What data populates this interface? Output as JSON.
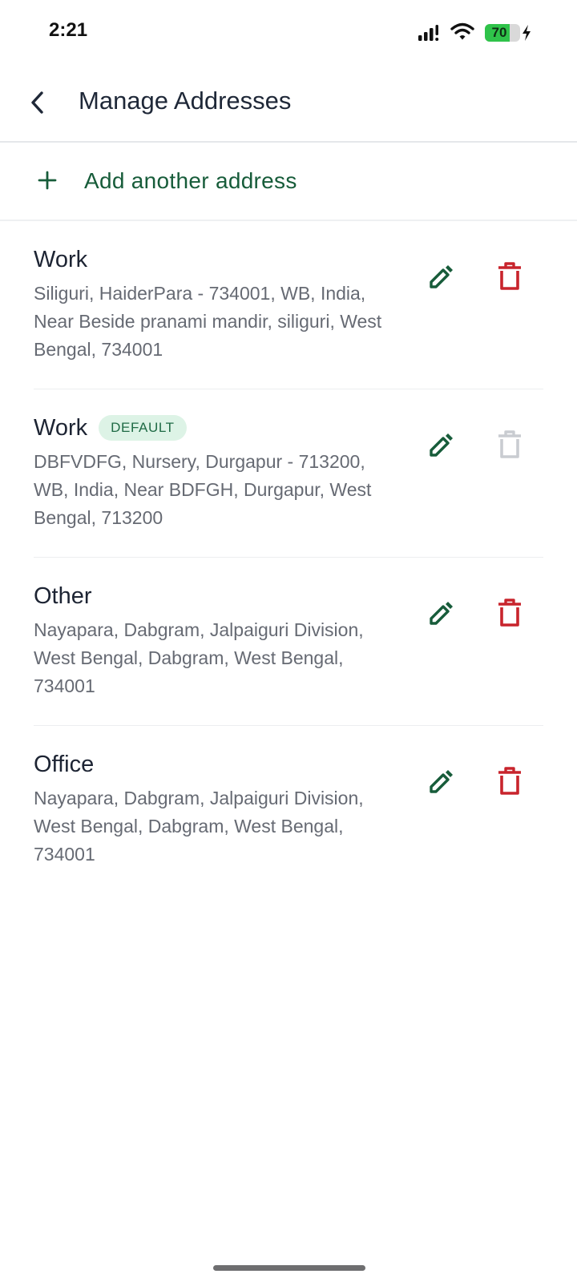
{
  "status_bar": {
    "time": "2:21",
    "battery_level": 70,
    "battery_text": "70",
    "icons": [
      "signal-icon",
      "wifi-icon",
      "battery-icon",
      "charging-bolt-icon"
    ]
  },
  "header": {
    "title": "Manage Addresses",
    "back_icon": "chevron-left-icon"
  },
  "add_address": {
    "label": "Add another address",
    "icon": "plus-icon"
  },
  "addresses": [
    {
      "title": "Work",
      "is_default": false,
      "badge": "",
      "text": "Siliguri, HaiderPara - 734001, WB, India, Near Beside pranami mandir, siliguri, West Bengal, 734001",
      "delete_enabled": true
    },
    {
      "title": "Work",
      "is_default": true,
      "badge": "DEFAULT",
      "text": "DBFVDFG, Nursery, Durgapur - 713200, WB, India, Near BDFGH, Durgapur, West Bengal, 713200",
      "delete_enabled": false
    },
    {
      "title": "Other",
      "is_default": false,
      "badge": "",
      "text": "Nayapara, Dabgram, Jalpaiguri Division, West Bengal, Dabgram, West Bengal, 734001",
      "delete_enabled": true
    },
    {
      "title": "Office",
      "is_default": false,
      "badge": "",
      "text": "Nayapara, Dabgram, Jalpaiguri Division, West Bengal, Dabgram, West Bengal, 734001",
      "delete_enabled": true
    }
  ],
  "colors": {
    "primary_green": "#175c3a",
    "delete_red": "#c8242c",
    "delete_disabled": "#c9ccd1",
    "badge_bg": "#ddf3e6",
    "badge_text": "#1f6b45"
  }
}
